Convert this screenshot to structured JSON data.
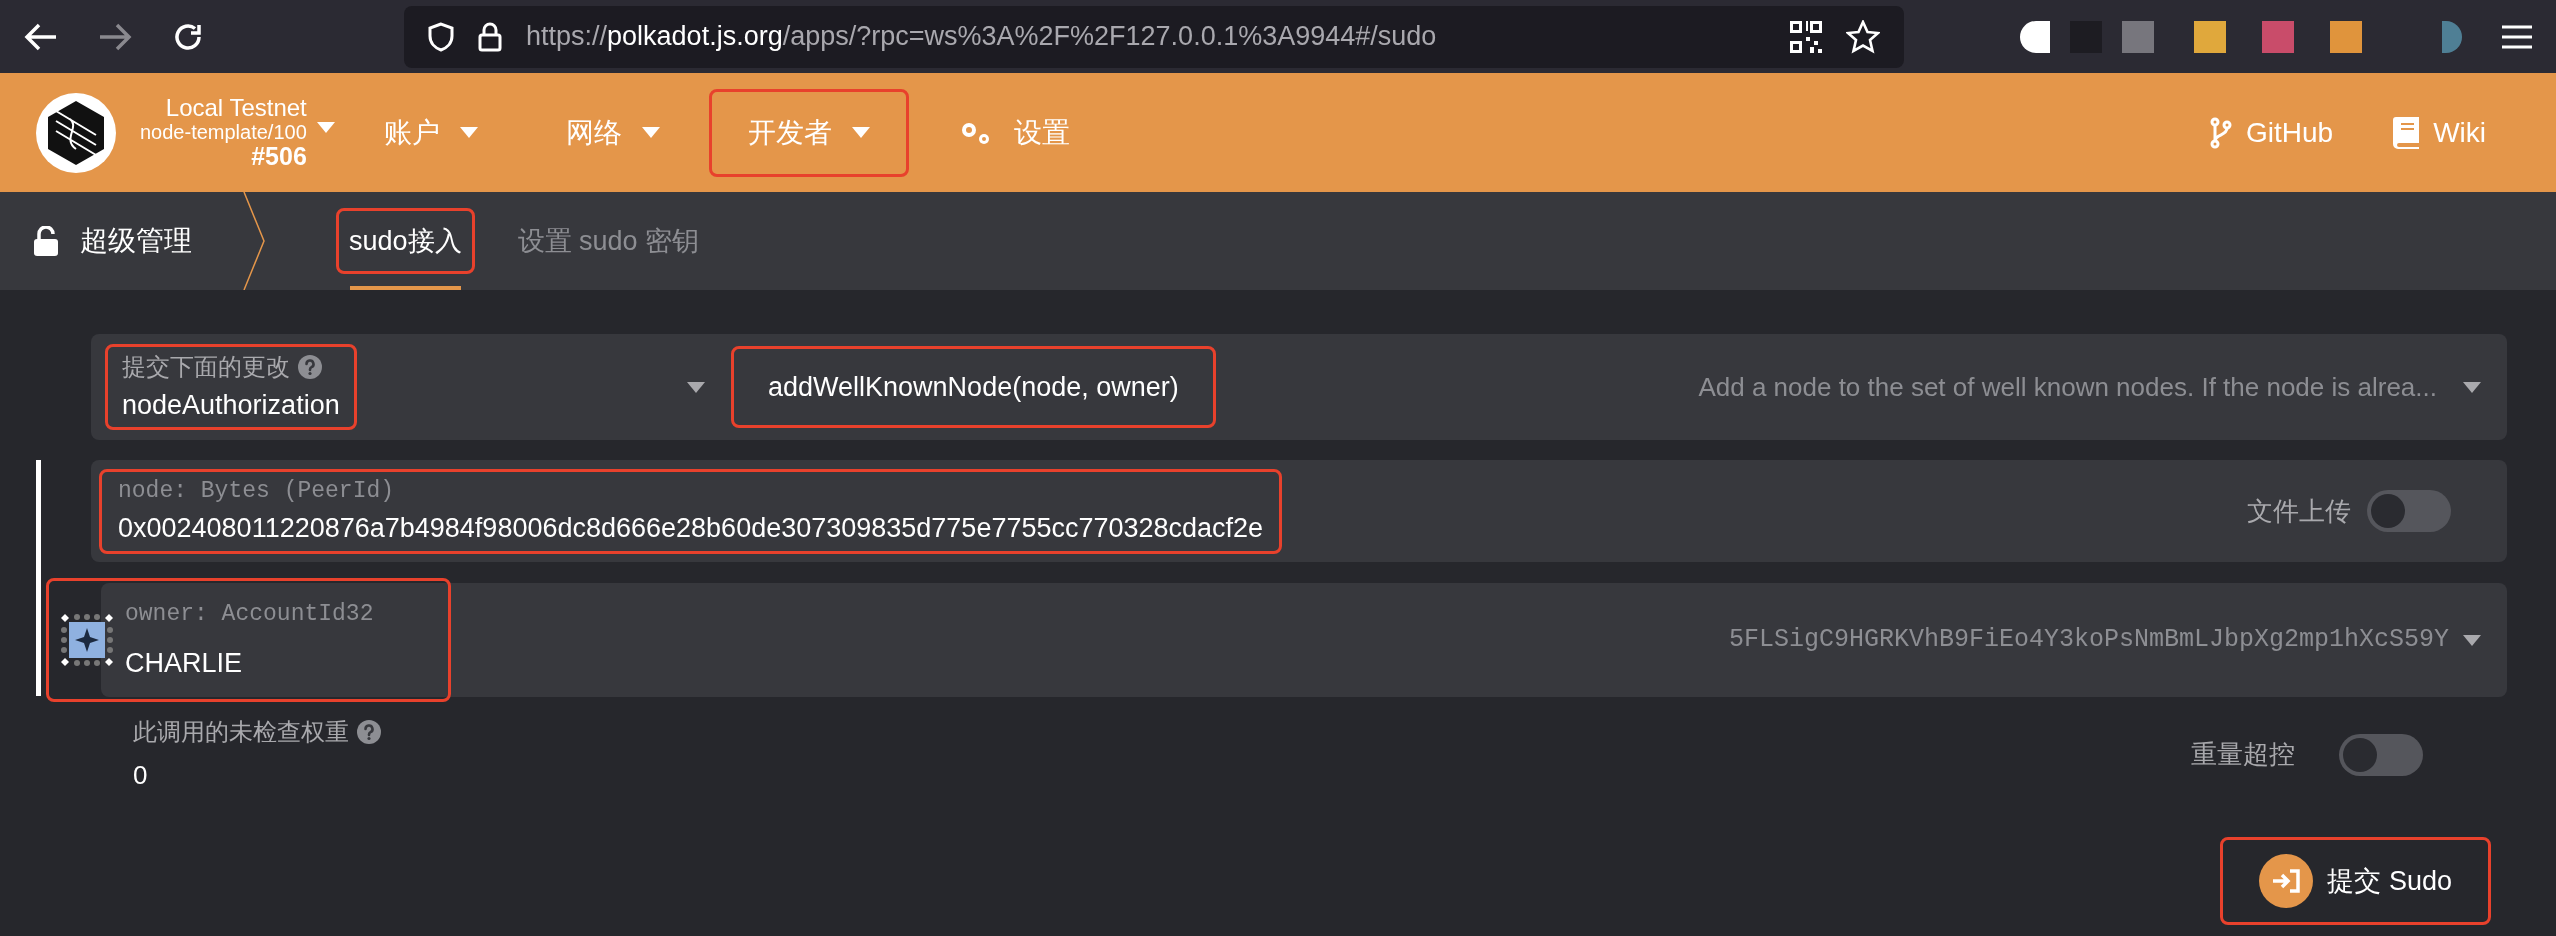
{
  "browser": {
    "url_scheme": "https://",
    "url_host": "polkadot.js.org",
    "url_path": "/apps/?rpc=ws%3A%2F%2F127.0.0.1%3A9944#/sudo"
  },
  "header": {
    "chain": {
      "name": "Local Testnet",
      "runtime": "node-template/100",
      "block": "#506"
    },
    "menu": [
      {
        "kind": "dropdown",
        "label": "账户",
        "highlighted": false
      },
      {
        "kind": "dropdown",
        "label": "网络",
        "highlighted": false
      },
      {
        "kind": "dropdown",
        "label": "开发者",
        "highlighted": true
      },
      {
        "kind": "settings",
        "label": "设置",
        "highlighted": false
      }
    ],
    "links": [
      {
        "kind": "github",
        "label": "GitHub"
      },
      {
        "kind": "wiki",
        "label": "Wiki"
      }
    ]
  },
  "subnav": {
    "title": "超级管理",
    "tabs": [
      {
        "label": "sudo接入",
        "selected": true,
        "highlighted": true
      },
      {
        "label": "设置 sudo 密钥",
        "selected": false,
        "highlighted": false
      }
    ]
  },
  "call": {
    "label": "提交下面的更改",
    "module": "nodeAuthorization",
    "module_highlighted": true,
    "method": "addWellKnownNode(node, owner)",
    "method_highlighted": true,
    "description": "Add a node to the set of well known nodes. If the node is alrea..."
  },
  "params": [
    {
      "kind": "bytes",
      "label": "node: Bytes (PeerId)",
      "value": "0x002408011220876a7b4984f98006dc8d666e28b60de307309835d775e7755cc770328cdacf2e",
      "toggle_label": "文件上传",
      "toggle_on": false,
      "highlighted": true
    },
    {
      "kind": "account",
      "label": "owner: AccountId32",
      "name": "CHARLIE",
      "address": "5FLSigC9HGRKVhB9FiEo4Y3koPsNmBmLJbpXg2mp1hXcS59Y",
      "highlighted": true
    }
  ],
  "weight": {
    "label": "此调用的未检查权重",
    "value": "0",
    "toggle_label": "重量超控",
    "toggle_on": false
  },
  "submit": {
    "label": "提交 Sudo",
    "highlighted": true
  }
}
